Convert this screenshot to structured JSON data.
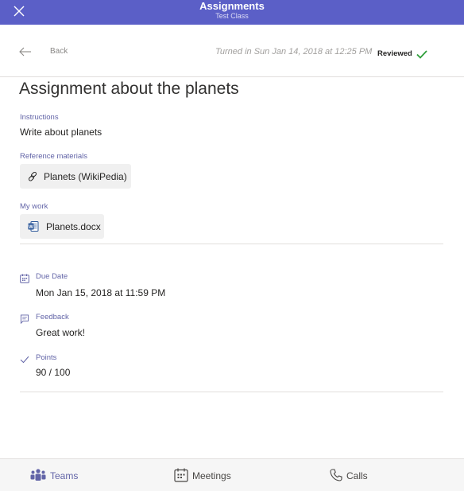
{
  "window": {
    "title": "Assignments",
    "subtitle": "Test Class",
    "close_icon": "close-icon"
  },
  "header": {
    "back_label": "Back",
    "turned_in": "Turned in Sun Jan 14, 2018 at 12:25 PM",
    "status": "Reviewed",
    "status_color": "#2e9e3a"
  },
  "assignment": {
    "title": "Assignment about the planets",
    "instructions_label": "Instructions",
    "instructions": "Write about planets",
    "reference_label": "Reference materials",
    "reference_item": "Planets (WikiPedia)",
    "reference_icon": "link-icon",
    "my_work_label": "My work",
    "my_work_item": "Planets.docx",
    "my_work_icon": "word-doc-icon"
  },
  "details": {
    "due_label": "Due Date",
    "due_value": "Mon Jan 15, 2018 at 11:59 PM",
    "due_icon": "calendar-icon",
    "feedback_label": "Feedback",
    "feedback_value": "Great work!",
    "feedback_icon": "comment-icon",
    "points_label": "Points",
    "points_value": "90 / 100",
    "points_icon": "checkmark-icon"
  },
  "tabs": [
    {
      "label": "Teams",
      "icon": "teams-icon",
      "active": true
    },
    {
      "label": "Meetings",
      "icon": "calendar-icon",
      "active": false
    },
    {
      "label": "Calls",
      "icon": "phone-icon",
      "active": false
    }
  ],
  "colors": {
    "accent": "#5b5fc7",
    "label_purple": "#6264a7",
    "active_tab": "#6264a7",
    "inactive_tab": "#484644"
  }
}
